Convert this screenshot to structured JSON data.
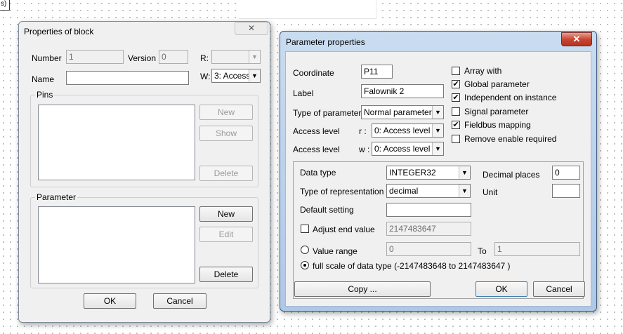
{
  "background_fragment": "s)",
  "props_block": {
    "title": "Properties of block",
    "close_glyph": "✕",
    "number_label": "Number",
    "number_value": "1",
    "version_label": "Version",
    "version_value": "0",
    "r_label": "R:",
    "name_label": "Name",
    "name_value": "",
    "w_label": "W:",
    "w_value": "3: Access",
    "pins_label": "Pins",
    "pins_new": "New",
    "pins_show": "Show",
    "pins_delete": "Delete",
    "parameter_label": "Parameter",
    "param_new": "New",
    "param_edit": "Edit",
    "param_delete": "Delete",
    "ok": "OK",
    "cancel": "Cancel"
  },
  "param_props": {
    "title": "Parameter properties",
    "close_glyph": "✕",
    "coordinate_label": "Coordinate",
    "coordinate_value": "P11",
    "label_label": "Label",
    "label_value": "Falownik 2",
    "type_label": "Type of parameter",
    "type_value": "Normal parameter",
    "access_label": "Access level",
    "access_r_prefix": "r :",
    "access_r_value": "0: Access level 0",
    "access_w_prefix": "w :",
    "access_w_value": "0: Access level 0",
    "checkboxes": [
      {
        "label": "Array with",
        "checked": false
      },
      {
        "label": "Global parameter",
        "checked": true
      },
      {
        "label": "Independent on instance",
        "checked": true
      },
      {
        "label": "Signal parameter",
        "checked": false
      },
      {
        "label": "Fieldbus mapping",
        "checked": true
      },
      {
        "label": "Remove enable required",
        "checked": false
      }
    ],
    "data_type_label": "Data type",
    "data_type_value": "INTEGER32",
    "decimal_places_label": "Decimal places",
    "decimal_places_value": "0",
    "representation_label": "Type of representation",
    "representation_value": "decimal",
    "unit_label": "Unit",
    "unit_value": "",
    "default_label": "Default setting",
    "default_value": "",
    "adjust_end_label": "Adjust end value",
    "adjust_end_value": "2147483647",
    "value_range_label": "Value range",
    "value_range_from": "0",
    "to_label": "To",
    "value_range_to": "1",
    "full_scale_label": "full scale of data type (-2147483648  to 2147483647 )",
    "copy_button": "Copy ...",
    "ok": "OK",
    "cancel": "Cancel"
  }
}
